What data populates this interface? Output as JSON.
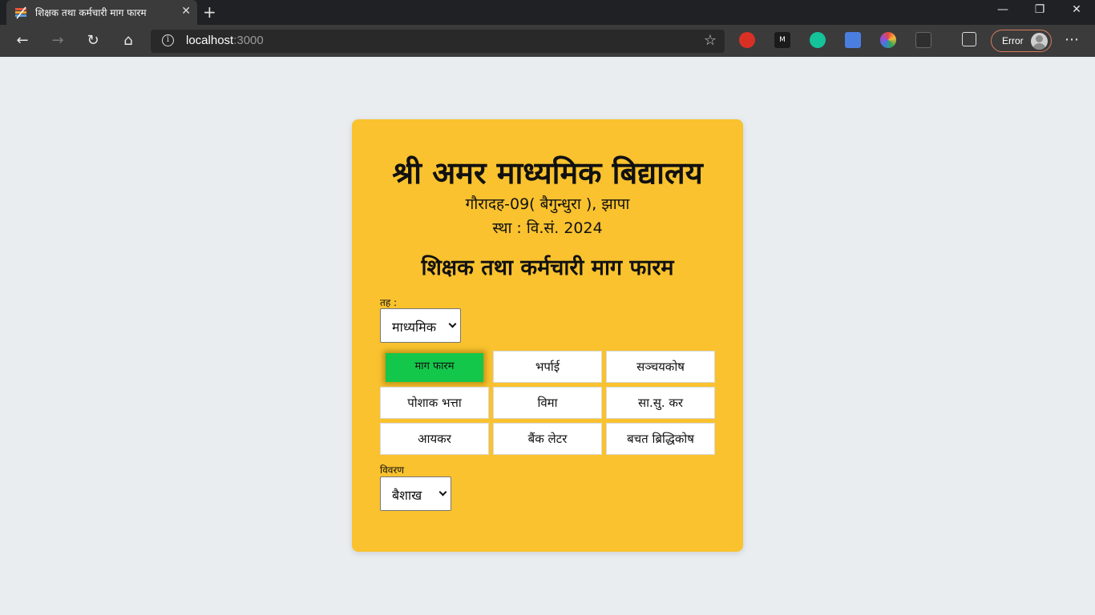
{
  "browser": {
    "tab_title": "शिक्षक तथा कर्मचारी माग फारम",
    "url_host": "localhost",
    "url_port": ":3000",
    "profile_label": "Error"
  },
  "school": {
    "name": "श्री अमर माध्यमिक बिद्यालय",
    "address": "गौरादह-09( बैगुन्धुरा ), झापा",
    "established": "स्था : वि.सं. 2024"
  },
  "form": {
    "title": "शिक्षक तथा कर्मचारी माग फारम",
    "level_label": "तह :",
    "level_value": "माध्यमिक",
    "buttons": [
      "माग फारम",
      "भर्पाई",
      "सञ्चयकोष",
      "पोशाक भत्ता",
      "विमा",
      "सा.सु. कर",
      "आयकर",
      "बैंक लेटर",
      "बचत ब्रिद्धिकोष"
    ],
    "active_button": "माग फारम",
    "details_label": "विवरण",
    "month_value": "बैशाख"
  },
  "colors": {
    "card_background": "#f9c22e",
    "active_button": "#12c74a",
    "page_background": "#e9edf0"
  }
}
